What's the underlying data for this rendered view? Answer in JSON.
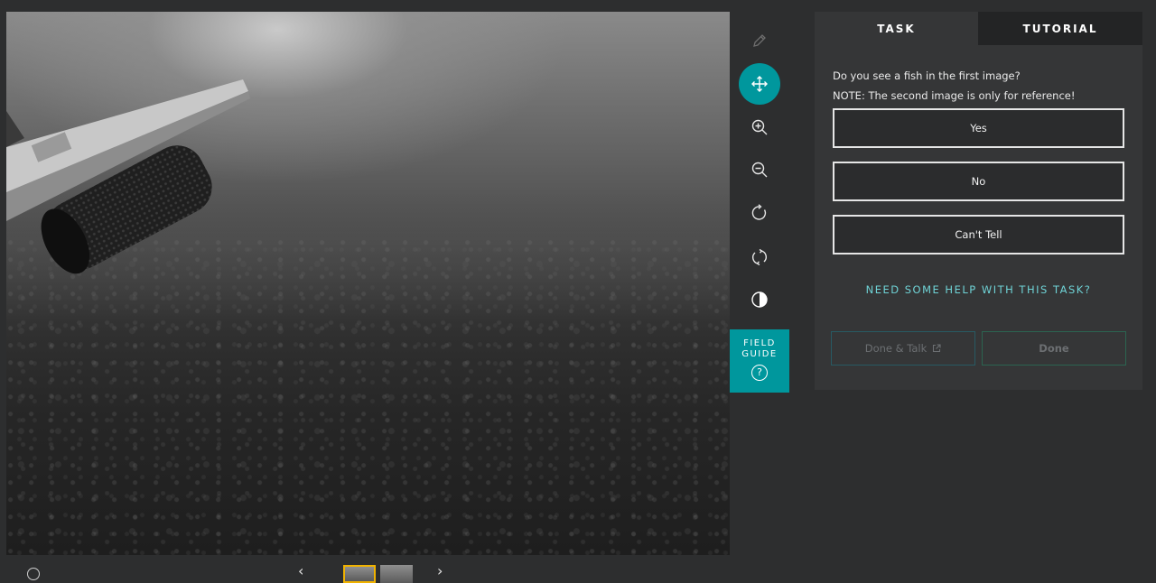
{
  "viewer": {
    "subject_description": "underwater camera view",
    "prev_arrow": "‹",
    "next_arrow": "›"
  },
  "tools": {
    "items": [
      {
        "name": "pencil",
        "icon": "pencil-icon",
        "active": false,
        "disabled": true
      },
      {
        "name": "move",
        "icon": "move-icon",
        "active": true
      },
      {
        "name": "zoom-in",
        "icon": "zoom-in-icon"
      },
      {
        "name": "zoom-out",
        "icon": "zoom-out-icon"
      },
      {
        "name": "rotate",
        "icon": "rotate-icon"
      },
      {
        "name": "flip",
        "icon": "flip-icon"
      },
      {
        "name": "invert",
        "icon": "invert-icon"
      }
    ],
    "field_guide_label": "FIELD\nGUIDE",
    "field_guide_icon": "?"
  },
  "panel": {
    "tabs": [
      {
        "label": "TASK",
        "active": true
      },
      {
        "label": "TUTORIAL",
        "active": false
      }
    ],
    "question_line1": "Do you see a fish in the first image?",
    "question_line2": "NOTE: The second image is only for reference!",
    "answers": [
      "Yes",
      "No",
      "Can't Tell"
    ],
    "help_link": "NEED SOME HELP WITH THIS TASK?",
    "done_talk_label": "Done & Talk",
    "done_label": "Done"
  },
  "colors": {
    "accent": "#00979d",
    "background": "#2d2e2f",
    "panel": "#353637",
    "help_link": "#6fd3d6",
    "thumb_active_border": "#f0b200"
  }
}
